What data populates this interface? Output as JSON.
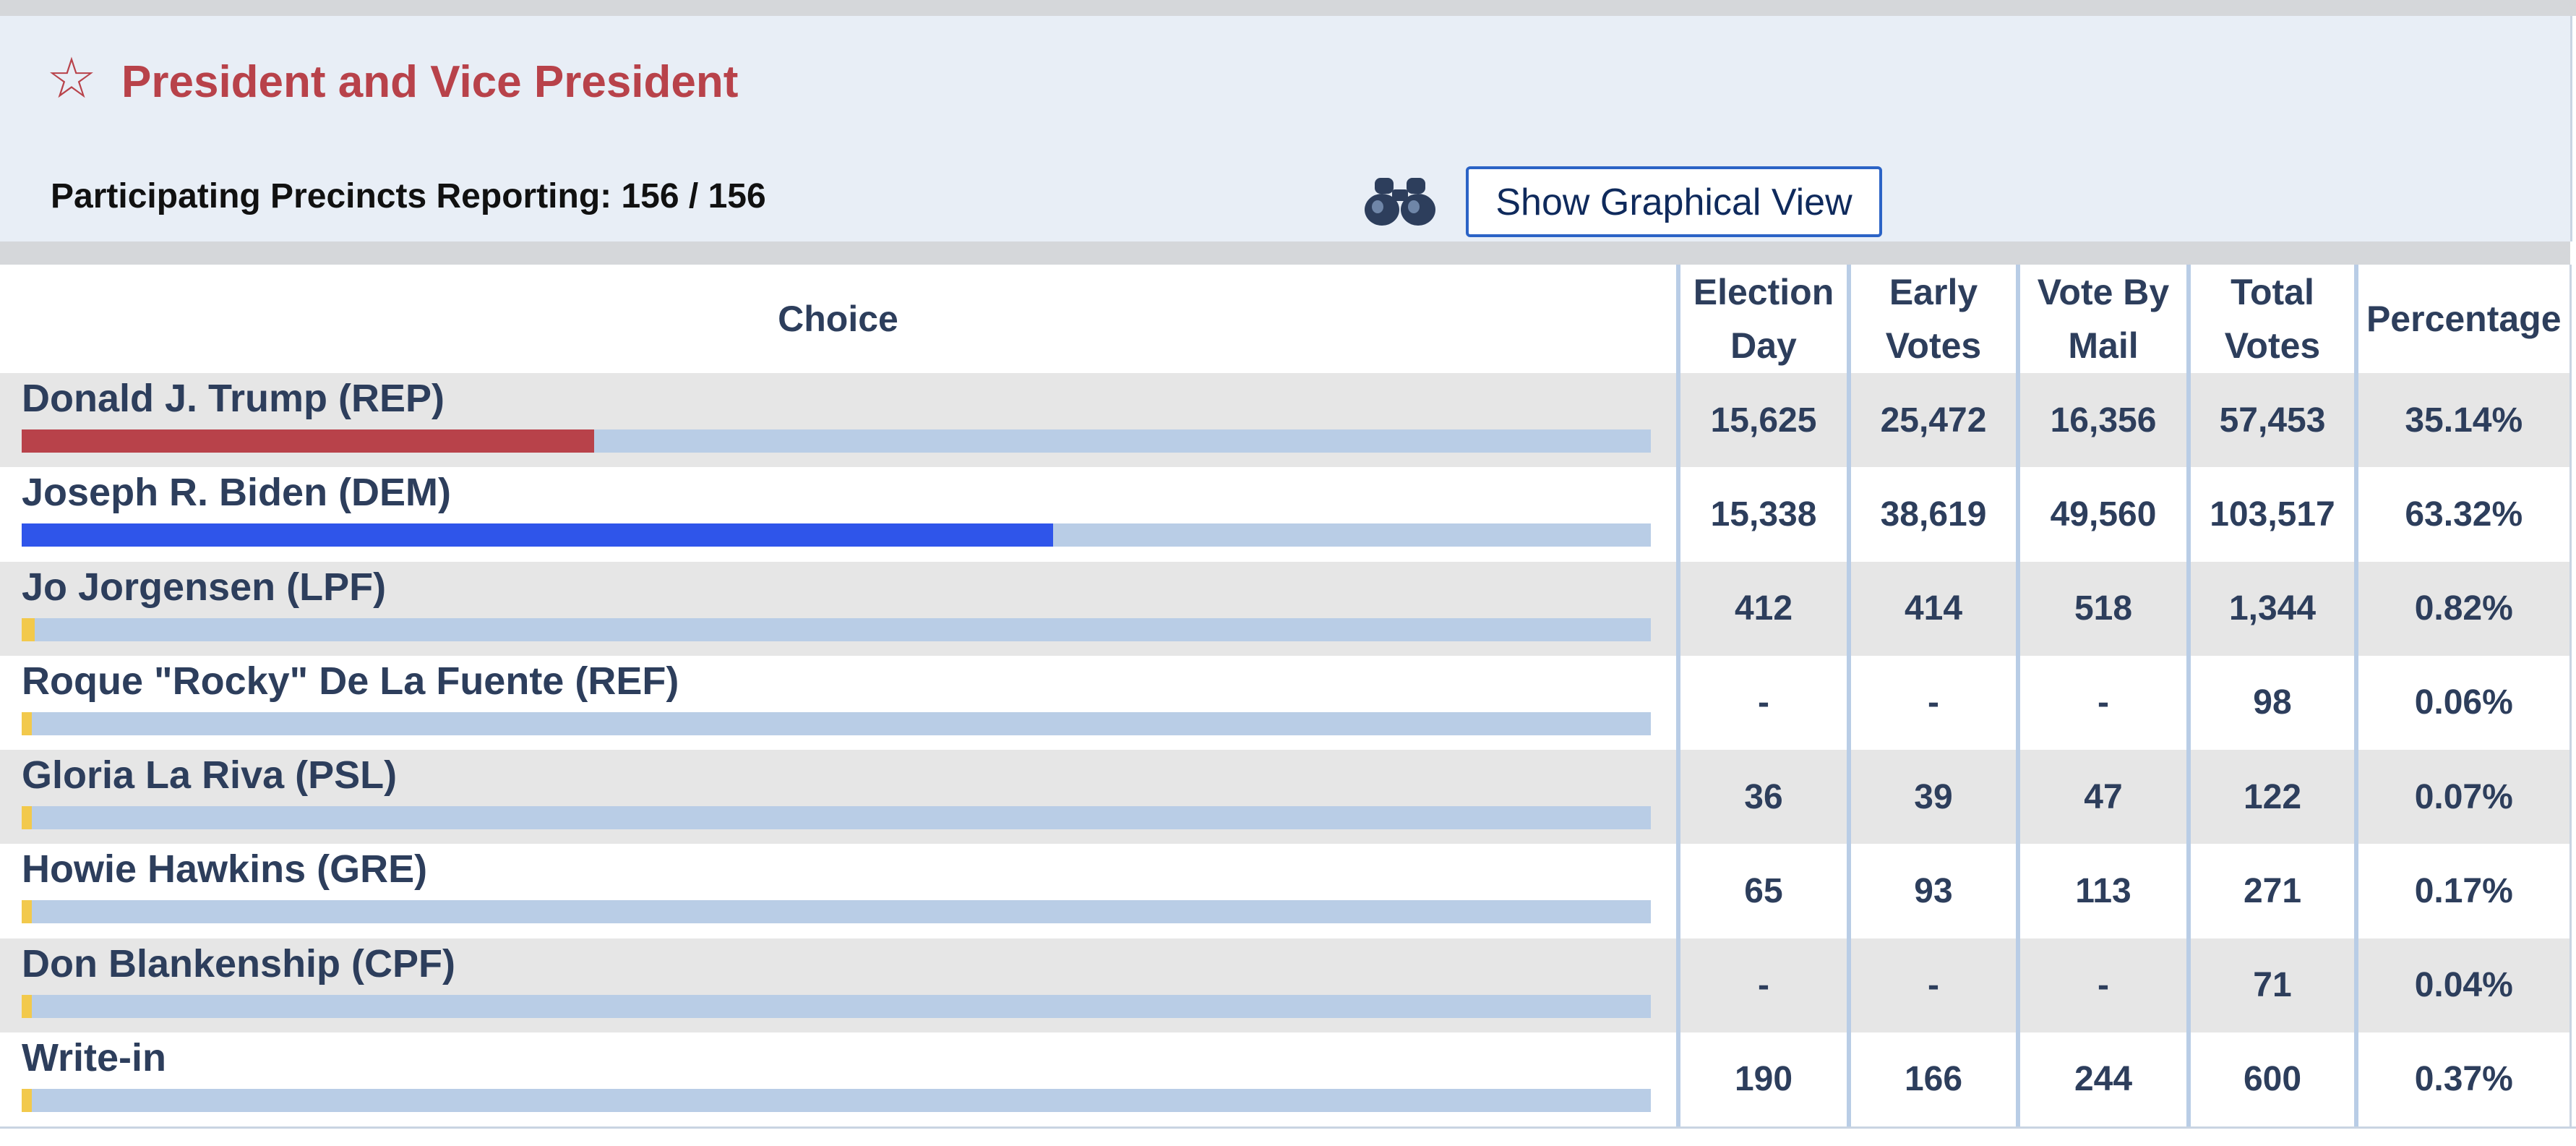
{
  "contest": {
    "title": "President and Vice President",
    "precincts_label": "Participating Precincts Reporting: 156 / 156",
    "graph_button_label": "Show Graphical View"
  },
  "icons": {
    "star": "star-outline-icon",
    "binoculars": "binoculars-icon"
  },
  "colors": {
    "title": "#b8424a",
    "rep": "#b8424a",
    "dem": "#2f55ea",
    "other": "#f2c94c",
    "track": "#b9cde6"
  },
  "table": {
    "headers": {
      "choice": "Choice",
      "election_day": [
        "Election",
        "Day"
      ],
      "early_votes": [
        "Early",
        "Votes"
      ],
      "vote_by_mail": [
        "Vote By",
        "Mail"
      ],
      "total_votes": [
        "Total",
        "Votes"
      ],
      "percentage": "Percentage"
    },
    "rows": [
      {
        "name": "Donald J. Trump (REP)",
        "election_day": "15,625",
        "early_votes": "25,472",
        "vote_by_mail": "16,356",
        "total": "57,453",
        "percentage": "35.14%",
        "share": 0.3514,
        "color": "#b8424a"
      },
      {
        "name": "Joseph R. Biden (DEM)",
        "election_day": "15,338",
        "early_votes": "38,619",
        "vote_by_mail": "49,560",
        "total": "103,517",
        "percentage": "63.32%",
        "share": 0.6332,
        "color": "#2f55ea"
      },
      {
        "name": "Jo Jorgensen (LPF)",
        "election_day": "412",
        "early_votes": "414",
        "vote_by_mail": "518",
        "total": "1,344",
        "percentage": "0.82%",
        "share": 0.0082,
        "color": "#f2c94c"
      },
      {
        "name": "Roque \"Rocky\" De La Fuente (REF)",
        "election_day": "-",
        "early_votes": "-",
        "vote_by_mail": "-",
        "total": "98",
        "percentage": "0.06%",
        "share": 0.0006,
        "color": "#f2c94c"
      },
      {
        "name": "Gloria La Riva (PSL)",
        "election_day": "36",
        "early_votes": "39",
        "vote_by_mail": "47",
        "total": "122",
        "percentage": "0.07%",
        "share": 0.0007,
        "color": "#f2c94c"
      },
      {
        "name": "Howie Hawkins (GRE)",
        "election_day": "65",
        "early_votes": "93",
        "vote_by_mail": "113",
        "total": "271",
        "percentage": "0.17%",
        "share": 0.0017,
        "color": "#f2c94c"
      },
      {
        "name": "Don Blankenship (CPF)",
        "election_day": "-",
        "early_votes": "-",
        "vote_by_mail": "-",
        "total": "71",
        "percentage": "0.04%",
        "share": 0.0004,
        "color": "#f2c94c"
      },
      {
        "name": "Write-in",
        "election_day": "190",
        "early_votes": "166",
        "vote_by_mail": "244",
        "total": "600",
        "percentage": "0.37%",
        "share": 0.0037,
        "color": "#f2c94c"
      }
    ]
  }
}
